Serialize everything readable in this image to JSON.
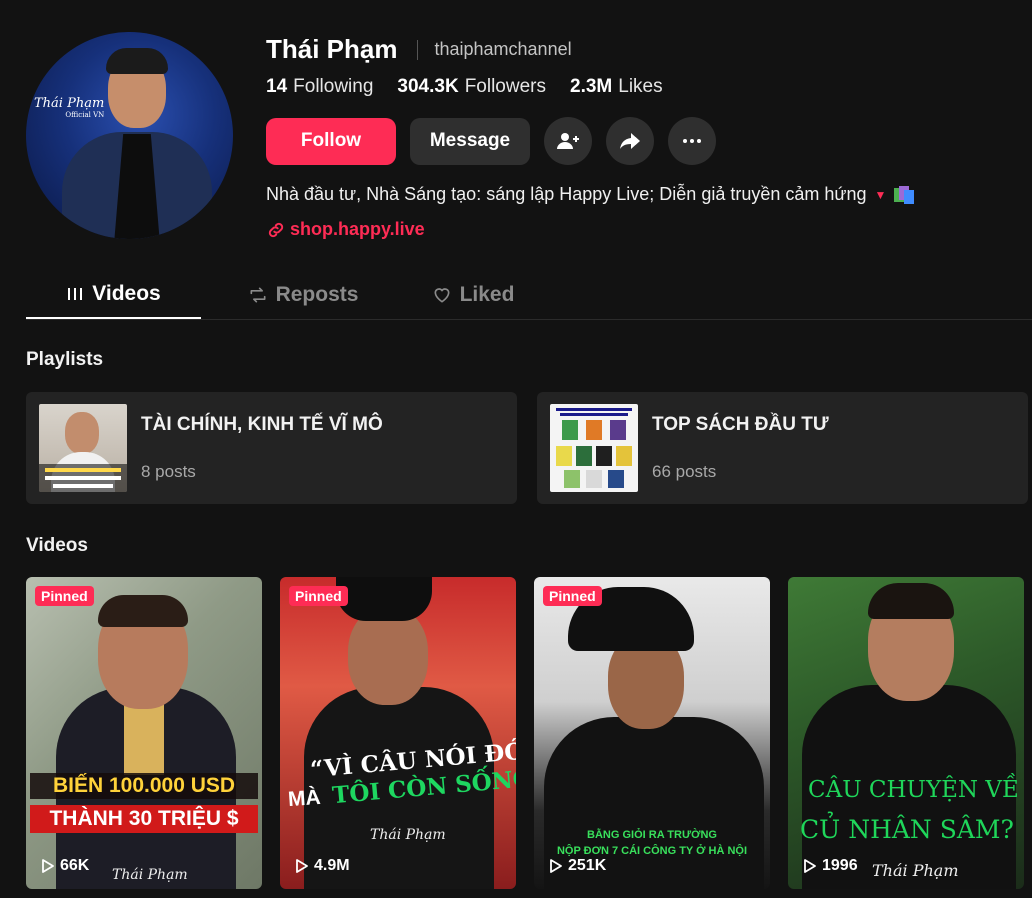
{
  "profile": {
    "name": "Thái Phạm",
    "handle": "thaiphamchannel",
    "avatar_signature": "Thái Phạm",
    "avatar_signature_sub": "Official VN",
    "stats": [
      {
        "value": "14",
        "label": "Following"
      },
      {
        "value": "304.3K",
        "label": "Followers"
      },
      {
        "value": "2.3M",
        "label": "Likes"
      }
    ],
    "bio": "Nhà đầu tư, Nhà Sáng tạo: sáng lập Happy Live; Diễn giả truyền cảm hứng",
    "link": "shop.happy.live"
  },
  "actions": {
    "follow_label": "Follow",
    "message_label": "Message",
    "icons": [
      "add-friend-icon",
      "share-icon",
      "more-icon"
    ]
  },
  "tabs": [
    {
      "label": "Videos",
      "icon": "grid-icon",
      "active": true
    },
    {
      "label": "Reposts",
      "icon": "repost-icon",
      "active": false
    },
    {
      "label": "Liked",
      "icon": "heart-outline-icon",
      "active": false
    }
  ],
  "sections": {
    "playlists_title": "Playlists",
    "videos_title": "Videos"
  },
  "playlists": [
    {
      "name": "TÀI CHÍNH, KINH TẾ VĨ MÔ",
      "count": "8 posts"
    },
    {
      "name": "TOP SÁCH ĐẦU TƯ",
      "count": "66 posts"
    }
  ],
  "videos": [
    {
      "pinned": "Pinned",
      "views": "66K",
      "caption_1": "BIẾN 100.000 USD",
      "caption_2": "THÀNH 30 TRIỆU $",
      "watermark": "Thái Phạm"
    },
    {
      "pinned": "Pinned",
      "views": "4.9M",
      "caption_1": "“VÌ CÂU NÓI ĐÓ",
      "caption_2a": "MÀ",
      "caption_2b": "TÔI CÒN SỐNG”",
      "watermark": "Thái Phạm"
    },
    {
      "pinned": "Pinned",
      "views": "251K",
      "caption_1": "BẰNG GIỎI RA TRƯỜNG",
      "caption_2": "NỘP ĐƠN 7 CÁI CÔNG TY Ở HÀ NỘI"
    },
    {
      "pinned": "",
      "views": "1996",
      "caption_1": "CÂU CHUYỆN VỀ",
      "caption_2": "CỦ NHÂN SÂM?",
      "watermark": "Thái Phạm"
    }
  ],
  "colors": {
    "accent": "#fe2c55",
    "background": "#121212",
    "card": "#232323",
    "button": "#2f2f2f"
  }
}
